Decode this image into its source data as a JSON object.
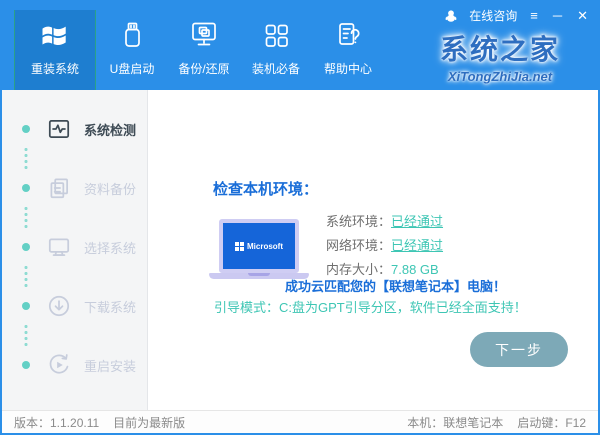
{
  "titlebar": {
    "online_service": "在线咨询",
    "menu_icon": "≡",
    "minimize_icon": "─",
    "close_icon": "✕"
  },
  "header": {
    "tabs": [
      {
        "label": "重装系统",
        "icon": "windows-logo-icon",
        "active": true
      },
      {
        "label": "U盘启动",
        "icon": "usb-drive-icon",
        "active": false
      },
      {
        "label": "备份/还原",
        "icon": "backup-restore-icon",
        "active": false
      },
      {
        "label": "装机必备",
        "icon": "apps-grid-icon",
        "active": false
      },
      {
        "label": "帮助中心",
        "icon": "help-doc-icon",
        "active": false
      }
    ],
    "logo": {
      "title": "系统之家",
      "subtitle": "XiTongZhiJia.net"
    }
  },
  "sidebar": {
    "items": [
      {
        "label": "系统检测",
        "icon": "system-check-icon",
        "active": true
      },
      {
        "label": "资料备份",
        "icon": "data-backup-icon",
        "active": false
      },
      {
        "label": "选择系统",
        "icon": "select-system-icon",
        "active": false
      },
      {
        "label": "下载系统",
        "icon": "download-icon",
        "active": false
      },
      {
        "label": "重启安装",
        "icon": "restart-install-icon",
        "active": false
      }
    ]
  },
  "main": {
    "title": "检查本机环境：",
    "laptop_brand": "Microsoft",
    "status": [
      {
        "label": "系统环境：",
        "value": "已经通过"
      },
      {
        "label": "网络环境：",
        "value": "已经通过"
      },
      {
        "label": "内存大小：",
        "value": "7.88 GB"
      }
    ],
    "match_message": "成功云匹配您的【联想笔记本】电脑！",
    "boot_message": "引导模式：C:盘为GPT引导分区，软件已经全面支持！",
    "next_button": "下一步"
  },
  "footer": {
    "version_label": "版本：1.1.20.11",
    "version_status": "目前为最新版",
    "machine_label": "本机：联想笔记本",
    "boot_key_label": "启动键：F12"
  },
  "colors": {
    "header_blue": "#2b8fe8",
    "active_tab_blue": "#1e7ed0",
    "active_tab_border_teal": "#2aa189",
    "accent_teal": "#3ec6b4",
    "timeline_dot_teal": "#63d0c5",
    "link_blue": "#1a6ed8",
    "next_button_gray_teal": "#7da9b7",
    "sidebar_bg": "#f4f5f6",
    "laptop_screen_blue": "#1565d9",
    "laptop_body_lavender": "#cbc9f1"
  }
}
